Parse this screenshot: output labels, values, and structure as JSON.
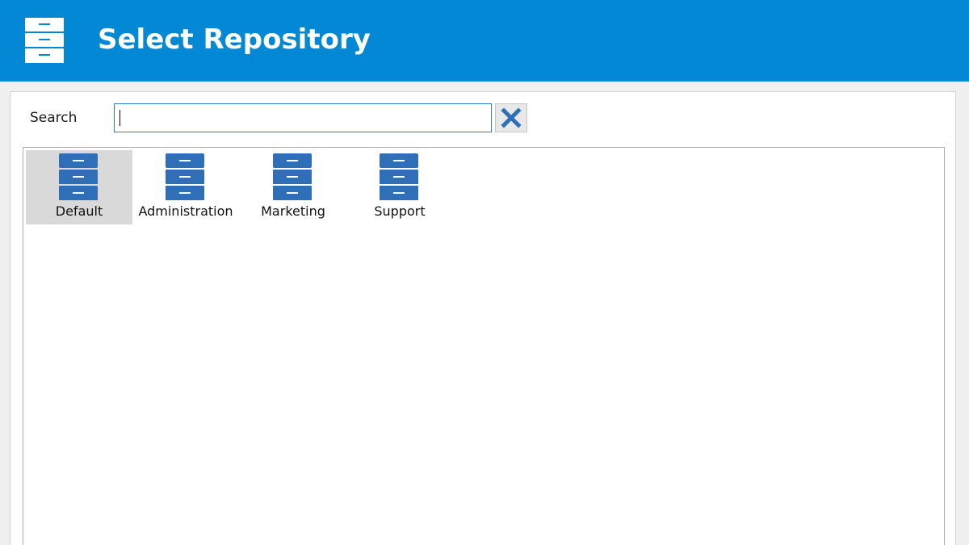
{
  "window": {
    "title": "Select Repository",
    "header_color": "#0288d4",
    "header_icon": "file-cabinet-icon"
  },
  "search": {
    "label": "Search",
    "value": "",
    "placeholder": "",
    "clear_icon": "close-icon"
  },
  "repositories": {
    "items": [
      {
        "label": "Default",
        "icon": "file-cabinet-icon",
        "selected": true
      },
      {
        "label": "Administration",
        "icon": "file-cabinet-icon",
        "selected": false
      },
      {
        "label": "Marketing",
        "icon": "file-cabinet-icon",
        "selected": false
      },
      {
        "label": "Support",
        "icon": "file-cabinet-icon",
        "selected": false
      }
    ],
    "icon_color": "#2f6fb8",
    "selection_color": "#d9d9d9"
  }
}
